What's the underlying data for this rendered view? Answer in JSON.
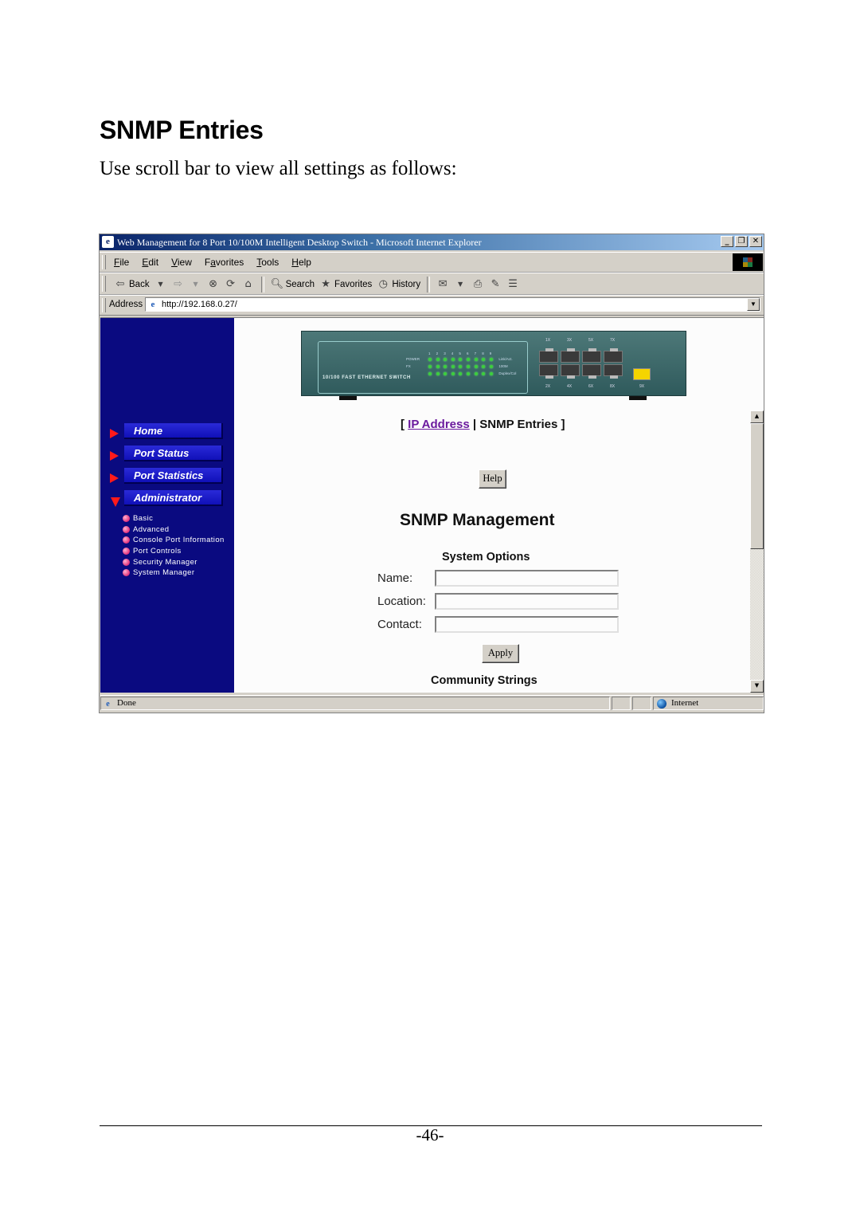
{
  "document": {
    "title": "SNMP Entries",
    "intro": "Use scroll bar to view all settings as follows:",
    "page_number": "-46-"
  },
  "browser": {
    "window_title": "Web Management for 8 Port 10/100M Intelligent Desktop Switch - Microsoft Internet Explorer",
    "window_buttons": {
      "minimize": "_",
      "restore": "❐",
      "close": "✕"
    },
    "menu": [
      {
        "label": "File",
        "accel": "F",
        "rest": "ile"
      },
      {
        "label": "Edit",
        "accel": "E",
        "rest": "dit"
      },
      {
        "label": "View",
        "accel": "V",
        "rest": "iew"
      },
      {
        "label": "Favorites",
        "accel": "a",
        "pre": "F",
        "rest": "vorites"
      },
      {
        "label": "Tools",
        "accel": "T",
        "rest": "ools"
      },
      {
        "label": "Help",
        "accel": "H",
        "rest": "elp"
      }
    ],
    "toolbar": {
      "back": "Back",
      "search": "Search",
      "favorites": "Favorites",
      "history": "History"
    },
    "address": {
      "label": "Address",
      "url": "http://192.168.0.27/"
    },
    "status": {
      "text": "Done",
      "zone": "Internet"
    }
  },
  "sidebar": {
    "items": [
      {
        "label": "Home",
        "expanded": false
      },
      {
        "label": "Port Status",
        "expanded": false
      },
      {
        "label": "Port Statistics",
        "expanded": false
      },
      {
        "label": "Administrator",
        "expanded": true
      }
    ],
    "sub_items": [
      "Basic",
      "Advanced",
      "Console Port Information",
      "Port Controls",
      "Security Manager",
      "System Manager"
    ]
  },
  "device": {
    "brand_text": "10/100 FAST ETHERNET SWITCH",
    "led_rows": [
      "POWER",
      "FX"
    ],
    "led_right_labels": [
      "Link/Act.",
      "100M",
      "Duplex/Col"
    ],
    "led_columns": [
      "1",
      "2",
      "3",
      "4",
      "5",
      "6",
      "7",
      "8",
      "9"
    ],
    "port_labels_top": [
      "1X",
      "3X",
      "5X",
      "7X"
    ],
    "port_labels_bottom": [
      "2X",
      "4X",
      "6X",
      "8X",
      "9X"
    ]
  },
  "content": {
    "breadcrumb_open": "[",
    "breadcrumb_link": "IP Address",
    "breadcrumb_sep": "|",
    "breadcrumb_current": "SNMP Entries",
    "breadcrumb_close": "]",
    "help_button": "Help",
    "heading": "SNMP Management",
    "system_options_heading": "System Options",
    "fields": [
      {
        "label": "Name:",
        "value": ""
      },
      {
        "label": "Location:",
        "value": ""
      },
      {
        "label": "Contact:",
        "value": ""
      }
    ],
    "apply_button": "Apply",
    "community_heading": "Community Strings"
  },
  "scrollbar": {
    "position_fraction": 0.0,
    "visible_fraction": 0.49
  },
  "colors": {
    "sidebar_bg": "#0a0a80",
    "nav_arrow": "#ff1a1a",
    "link_visited": "#6b1a9e",
    "title_bar": "#0a246a",
    "chrome": "#d4d0c8"
  }
}
